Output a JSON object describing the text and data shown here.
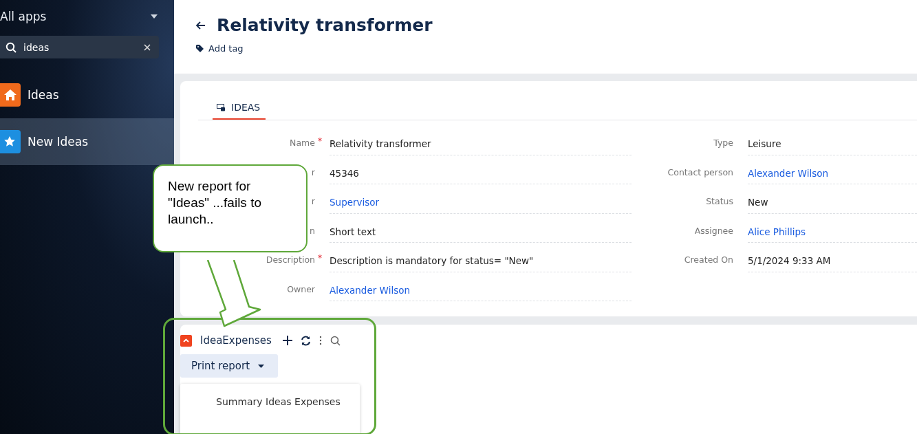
{
  "sidebar": {
    "title": "All apps",
    "search": {
      "value": "ideas"
    },
    "items": [
      {
        "label": "Ideas",
        "kind": "home",
        "selected": false
      },
      {
        "label": "New Ideas",
        "kind": "star",
        "selected": true
      }
    ]
  },
  "header": {
    "title": "Relativity transformer",
    "tag_action": "Add tag"
  },
  "tabs": [
    {
      "label": "IDEAS",
      "selected": true
    }
  ],
  "form": {
    "required_marker": "*",
    "left": [
      {
        "label": "Name",
        "required": true,
        "value": "Relativity transformer",
        "kind": "text"
      },
      {
        "label": "r",
        "required": false,
        "value": "45346",
        "kind": "text"
      },
      {
        "label": "r",
        "required": false,
        "value": "Supervisor",
        "kind": "link"
      },
      {
        "label": "n",
        "required": false,
        "value": "Short text",
        "kind": "text"
      },
      {
        "label": "Description",
        "required": true,
        "value": "Description is mandatory for status= \"New\"",
        "kind": "text"
      },
      {
        "label": "Owner",
        "required": false,
        "value": "Alexander Wilson",
        "kind": "link"
      }
    ],
    "right": [
      {
        "label": "Type",
        "required": false,
        "value": "Leisure",
        "kind": "text"
      },
      {
        "label": "Contact person",
        "required": false,
        "value": "Alexander Wilson",
        "kind": "link"
      },
      {
        "label": "Status",
        "required": false,
        "value": "New",
        "kind": "text"
      },
      {
        "label": "Assignee",
        "required": false,
        "value": "Alice Phillips",
        "kind": "link"
      },
      {
        "label": "Created On",
        "required": false,
        "value": "5/1/2024 9:33 AM",
        "kind": "text"
      }
    ]
  },
  "detail": {
    "title": "IdeaExpenses",
    "expanded": true,
    "print_button": "Print report",
    "menu": [
      "Summary Ideas Expenses"
    ]
  },
  "callout": {
    "text": "New report for \"Ideas\" ...fails to launch.."
  }
}
